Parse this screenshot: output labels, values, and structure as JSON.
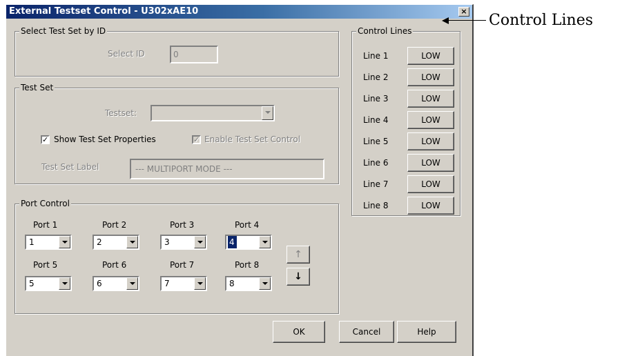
{
  "dialog": {
    "title": "External Testset Control - U302xAE10",
    "close_glyph": "×"
  },
  "select_by_id": {
    "group_label": "Select Test Set by ID",
    "label": "Select ID",
    "value": "0"
  },
  "test_set": {
    "group_label": "Test Set",
    "testset_label": "Testset:",
    "testset_value": "",
    "show_props_label": "Show Test Set Properties",
    "show_props_checked": true,
    "enable_control_label": "Enable Test Set Control",
    "enable_control_checked": true,
    "label_label": "Test Set Label",
    "label_value": "--- MULTIPORT MODE ---"
  },
  "port_control": {
    "group_label": "Port Control",
    "ports": [
      {
        "label": "Port 1",
        "value": "1"
      },
      {
        "label": "Port 2",
        "value": "2"
      },
      {
        "label": "Port 3",
        "value": "3"
      },
      {
        "label": "Port 4",
        "value": "4"
      },
      {
        "label": "Port 5",
        "value": "5"
      },
      {
        "label": "Port 6",
        "value": "6"
      },
      {
        "label": "Port 7",
        "value": "7"
      },
      {
        "label": "Port 8",
        "value": "8"
      }
    ],
    "up_glyph": "↑",
    "down_glyph": "↓"
  },
  "control_lines": {
    "group_label": "Control Lines",
    "lines": [
      {
        "label": "Line 1",
        "state": "LOW"
      },
      {
        "label": "Line 2",
        "state": "LOW"
      },
      {
        "label": "Line 3",
        "state": "LOW"
      },
      {
        "label": "Line 4",
        "state": "LOW"
      },
      {
        "label": "Line 5",
        "state": "LOW"
      },
      {
        "label": "Line 6",
        "state": "LOW"
      },
      {
        "label": "Line 7",
        "state": "LOW"
      },
      {
        "label": "Line 8",
        "state": "LOW"
      }
    ]
  },
  "buttons": {
    "ok": "OK",
    "cancel": "Cancel",
    "help": "Help"
  },
  "annotation": {
    "text": "Control Lines"
  },
  "colors": {
    "face": "#d4d0c8",
    "title_start": "#0a246a",
    "title_end": "#a6caf0",
    "selection": "#0a246a"
  }
}
